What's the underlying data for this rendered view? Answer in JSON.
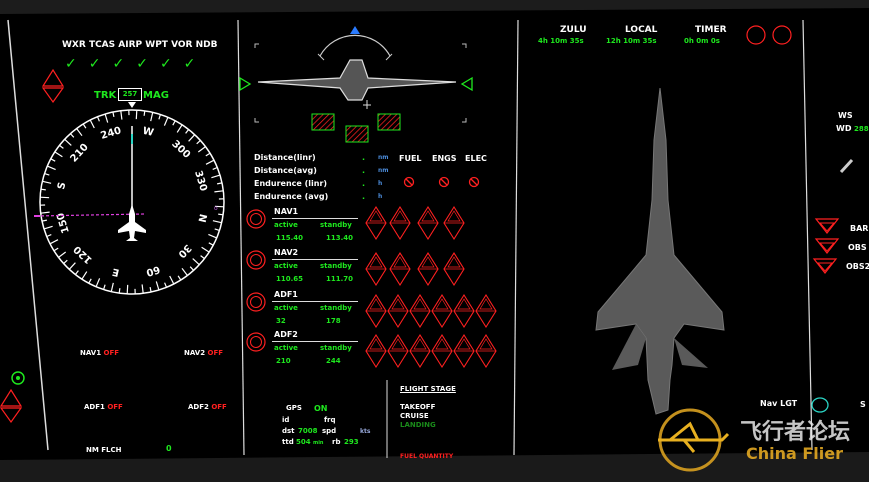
{
  "filters": {
    "labels": [
      "WXR",
      "TCAS",
      "AIRP",
      "WPT",
      "VOR",
      "NDB"
    ],
    "checks": [
      "✓",
      "✓",
      "✓",
      "✓",
      "✓",
      "✓"
    ]
  },
  "compass": {
    "trk": "TRK",
    "heading": "257",
    "mag": "MAG",
    "cardinals": [
      "W",
      "30",
      "33",
      "N",
      "3",
      "6",
      "E",
      "12",
      "15",
      "S",
      "21",
      "24"
    ],
    "ticks": [
      "240",
      "W",
      "300",
      "330",
      "N",
      "30",
      "60",
      "E",
      "120",
      "150",
      "S",
      "210"
    ]
  },
  "radio_off": {
    "nav1": "NAV1",
    "nav1_state": "OFF",
    "nav2": "NAV2",
    "nav2_state": "OFF",
    "adf1": "ADF1",
    "adf1_state": "OFF",
    "adf2": "ADF2",
    "adf2_state": "OFF",
    "nm_flch": "NM FLCH",
    "nm_flch_val": "0"
  },
  "distance": {
    "rows": [
      {
        "label": "Distance(linr)",
        "dot": ".",
        "unit": "nm"
      },
      {
        "label": "Distance(avg)",
        "dot": ".",
        "unit": "nm"
      },
      {
        "label": "Endurence (linr)",
        "dot": ".",
        "unit": "h"
      },
      {
        "label": "Endurence (avg)",
        "dot": ".",
        "unit": "h"
      }
    ]
  },
  "systems": {
    "fuel": "FUEL",
    "engs": "ENGS",
    "elec": "ELEC"
  },
  "radios": [
    {
      "name": "NAV1",
      "active_lbl": "active",
      "standby_lbl": "standby",
      "active": "115.40",
      "standby": "113.40"
    },
    {
      "name": "NAV2",
      "active_lbl": "active",
      "standby_lbl": "standby",
      "active": "110.65",
      "standby": "111.70"
    },
    {
      "name": "ADF1",
      "active_lbl": "active",
      "standby_lbl": "standby",
      "active": "32",
      "standby": "178"
    },
    {
      "name": "ADF2",
      "active_lbl": "active",
      "standby_lbl": "standby",
      "active": "210",
      "standby": "244"
    }
  ],
  "gps": {
    "label": "GPS",
    "state": "ON",
    "id": "id",
    "frq": "frq",
    "dst": "dst",
    "dst_val": "7008",
    "spd": "spd",
    "kts": "kts",
    "ttd": "ttd",
    "ttd_val": "504",
    "min": "min",
    "rb": "rb",
    "rb_val": "293"
  },
  "flight_stage": {
    "title": "FLIGHT STAGE",
    "takeoff": "TAKEOFF",
    "cruise": "CRUISE",
    "landing": "LANDING",
    "fuel_qty": "FUEL QUANTITY"
  },
  "clocks": {
    "zulu": "ZULU",
    "zulu_val": "4h 10m 35s",
    "local": "LOCAL",
    "local_val": "12h 10m 35s",
    "timer": "TIMER",
    "timer_val": "0h 0m 0s"
  },
  "right": {
    "ws": "WS",
    "wd": "WD",
    "wd_val": "288",
    "bar": "BAR",
    "obs1": "OBS",
    "obs2": "OBS2",
    "nav_lgt": "Nav LGT",
    "s_lbl": "S"
  },
  "watermark": {
    "cn": "飞行者论坛",
    "en": "China Flier"
  },
  "colors": {
    "green": "#1ee81e",
    "red": "#ff2020",
    "white": "#ffffff",
    "panel": "#0b0b0b"
  }
}
